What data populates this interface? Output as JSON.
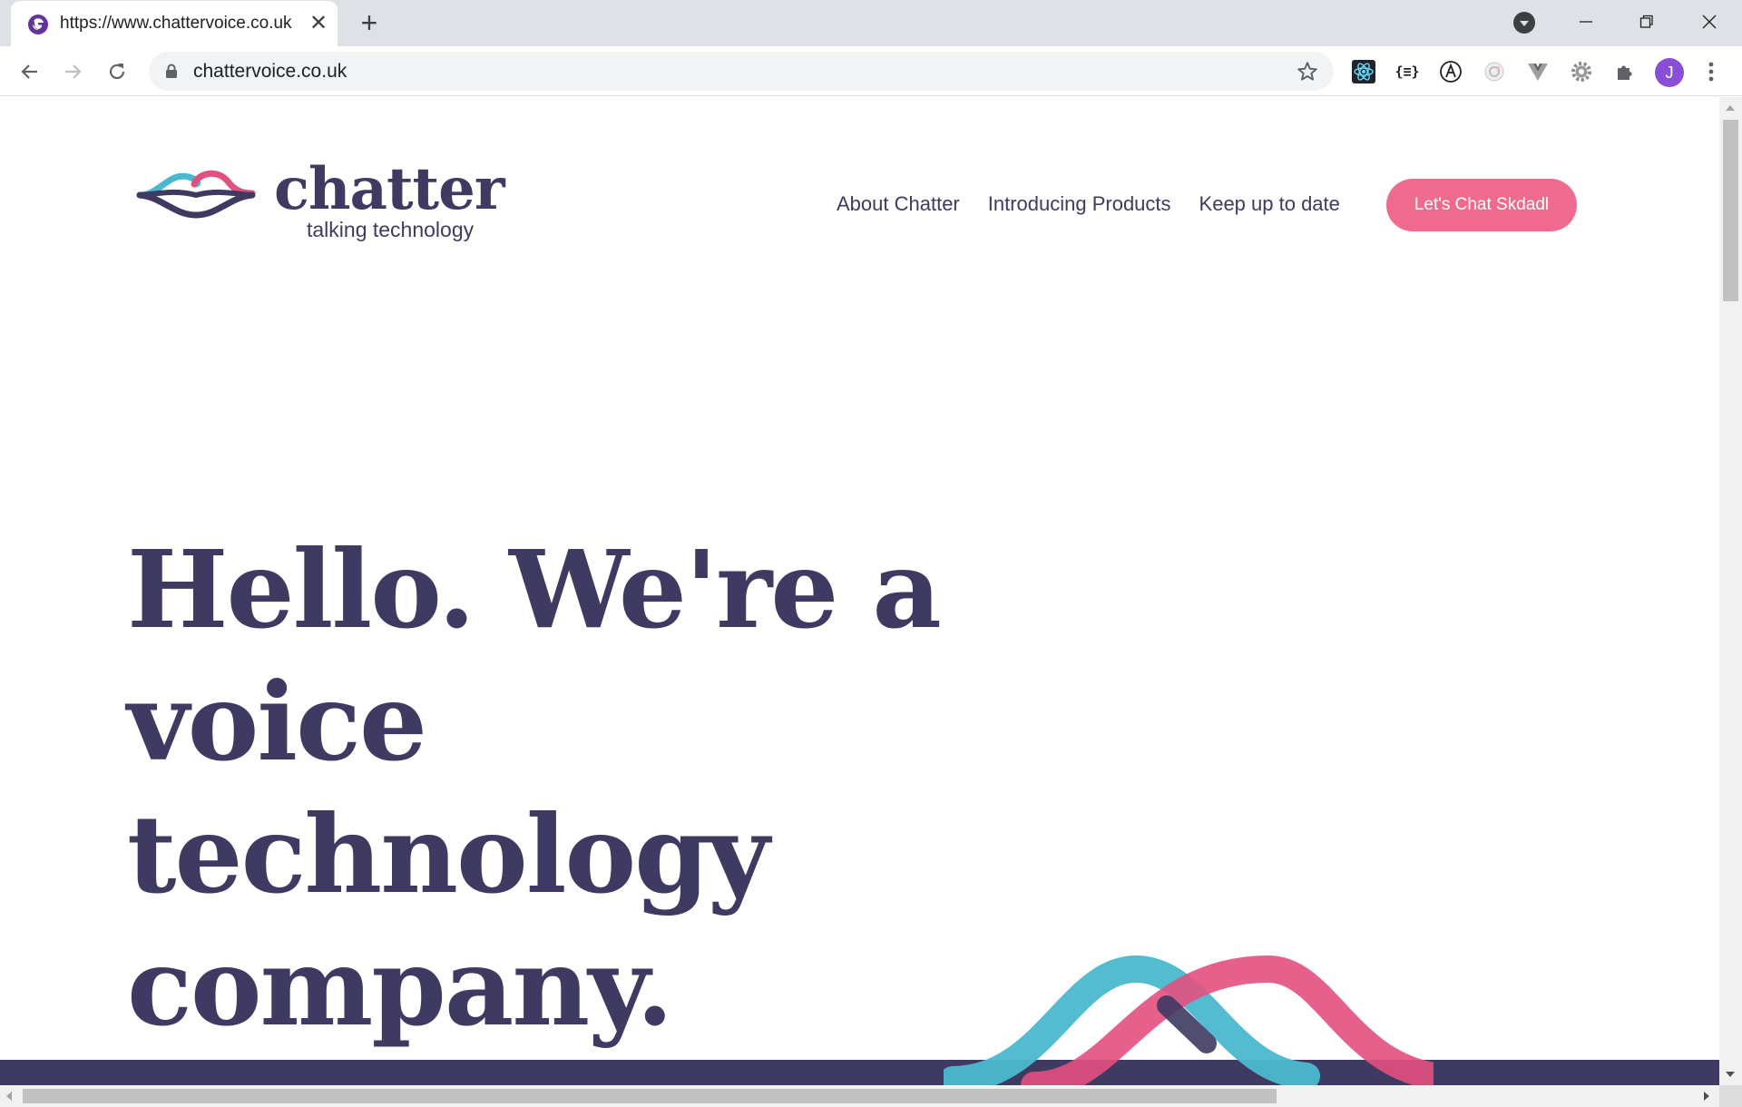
{
  "browser": {
    "tab_title": "https://www.chattervoice.co.uk",
    "url": "chattervoice.co.uk",
    "avatar_letter": "J",
    "extensions": [
      "react-devtools-icon",
      "json-formatter-icon",
      "a11y-icon",
      "color-picker-icon",
      "vue-devtools-icon",
      "settings-gear-icon",
      "puzzle-extensions-icon"
    ]
  },
  "site": {
    "logo": {
      "wordmark": "chatter",
      "tagline": "talking technology"
    },
    "nav": [
      {
        "label": "About Chatter"
      },
      {
        "label": "Introducing Products"
      },
      {
        "label": "Keep up to date"
      }
    ],
    "cta_label": "Let's Chat Skdadl",
    "hero": {
      "line1": "Hello. We're a",
      "line2": "voice technology",
      "line3": "company."
    }
  },
  "colors": {
    "brand_navy": "#3e3a62",
    "brand_pink": "#ee6b8f",
    "wave_teal": "#4bb8cf",
    "wave_pink": "#e2507e"
  }
}
